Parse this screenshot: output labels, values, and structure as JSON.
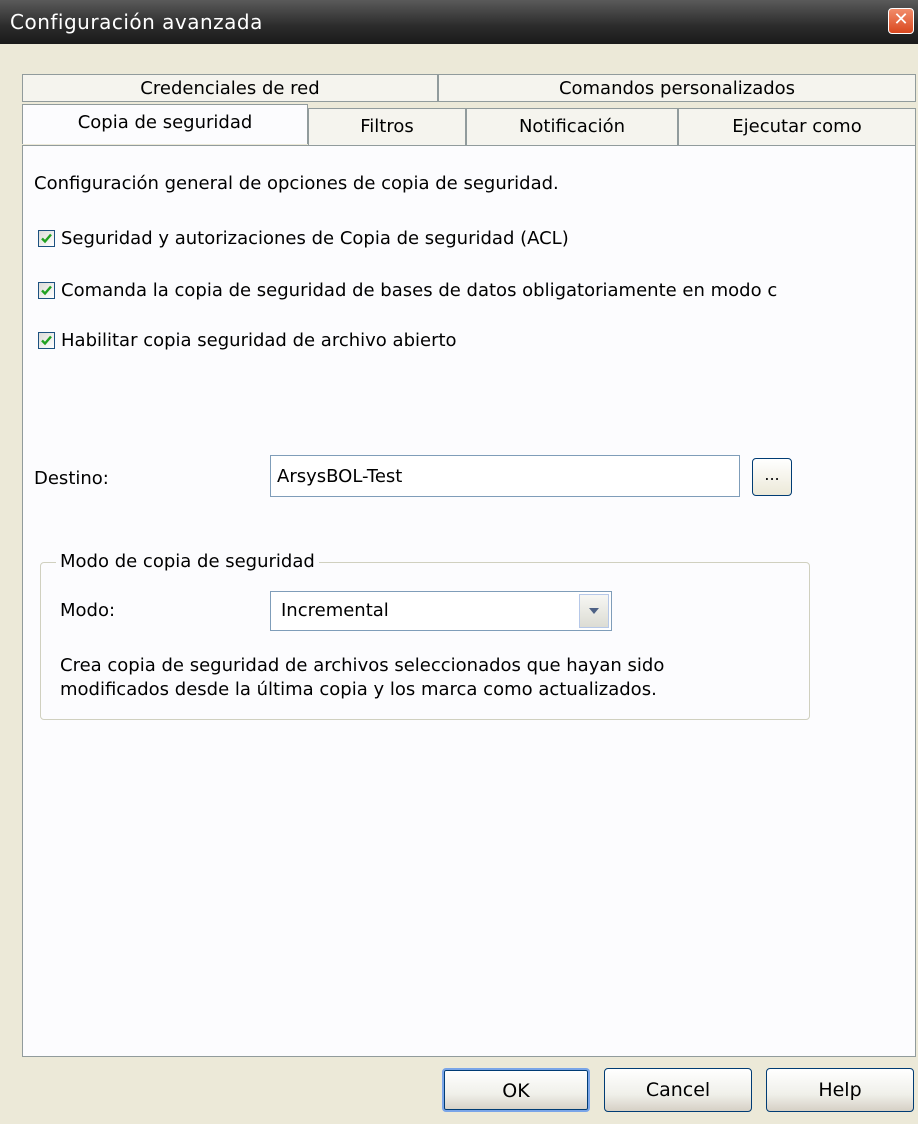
{
  "window": {
    "title": "Configuración avanzada",
    "close_symbol": "✕"
  },
  "tabs": {
    "row1": [
      "Credenciales de red",
      "Comandos personalizados"
    ],
    "row2": [
      "Copia de seguridad",
      "Filtros",
      "Notificación",
      "Ejecutar como"
    ],
    "active": "Copia de seguridad"
  },
  "panel": {
    "description": "Configuración general de opciones de copia de seguridad.",
    "checkboxes": [
      {
        "label": "Seguridad y autorizaciones de Copia de seguridad (ACL)",
        "checked": true
      },
      {
        "label": "Comanda la copia de seguridad de bases de datos obligatoriamente en modo c",
        "checked": true
      },
      {
        "label": "Habilitar copia seguridad de archivo abierto",
        "checked": true
      }
    ],
    "destino_label": "Destino:",
    "destino_value": "ArsysBOL-Test",
    "browse_label": "...",
    "mode_group": {
      "title": "Modo de copia de seguridad",
      "mode_label": "Modo:",
      "mode_value": "Incremental",
      "mode_description_line1": "Crea copia de seguridad de archivos seleccionados que hayan sido",
      "mode_description_line2": "modificados desde la última copia y los marca como actualizados."
    }
  },
  "buttons": {
    "ok": "OK",
    "cancel": "Cancel",
    "help": "Help"
  }
}
